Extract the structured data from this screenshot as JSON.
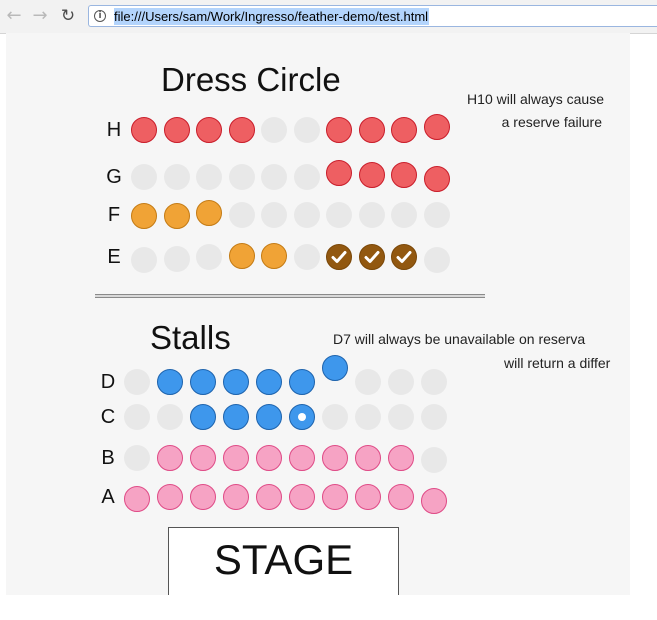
{
  "browser": {
    "back_icon": "arrow-left-icon",
    "forward_icon": "arrow-right-icon",
    "reload_icon": "reload-icon",
    "info_icon": "info-icon",
    "url": "file:///Users/sam/Work/Ingresso/feather-demo/test.html"
  },
  "seat_colors": {
    "unavailable": "#e8e8e8",
    "red": "#ee5f62",
    "orange": "#f0a336",
    "selected": "#925810",
    "blue": "#3e97ec",
    "pink": "#f6a3c4"
  },
  "dress_circle": {
    "title": "Dress Circle",
    "note_line1": "H10 will always cause",
    "note_line2": "a reserve failure",
    "rows": [
      {
        "label": "H",
        "seats": [
          "red",
          "red",
          "red",
          "red",
          "unavailable",
          "unavailable",
          "red",
          "red",
          "red",
          "red"
        ]
      },
      {
        "label": "G",
        "seats": [
          "unavailable",
          "unavailable",
          "unavailable",
          "unavailable",
          "unavailable",
          "unavailable",
          "red",
          "red",
          "red",
          "red"
        ]
      },
      {
        "label": "F",
        "seats": [
          "orange",
          "orange",
          "orange",
          "unavailable",
          "unavailable",
          "unavailable",
          "unavailable",
          "unavailable",
          "unavailable",
          "unavailable"
        ]
      },
      {
        "label": "E",
        "seats": [
          "unavailable",
          "unavailable",
          "unavailable",
          "orange",
          "orange",
          "unavailable",
          "selected",
          "selected",
          "selected",
          "unavailable"
        ]
      }
    ]
  },
  "stalls": {
    "title": "Stalls",
    "note_line1": "D7 will always be unavailable on reserva",
    "note_line2": "will return a differ",
    "rows": [
      {
        "label": "D",
        "seats": [
          "unavailable",
          "blue",
          "blue",
          "blue",
          "blue",
          "blue",
          "blue",
          "unavailable",
          "unavailable",
          "unavailable"
        ]
      },
      {
        "label": "C",
        "seats": [
          "unavailable",
          "unavailable",
          "blue",
          "blue",
          "blue",
          "blue-dot",
          "unavailable",
          "unavailable",
          "unavailable",
          "unavailable"
        ]
      },
      {
        "label": "B",
        "seats": [
          "unavailable",
          "pink",
          "pink",
          "pink",
          "pink",
          "pink",
          "pink",
          "pink",
          "pink",
          "unavailable"
        ]
      },
      {
        "label": "A",
        "seats": [
          "pink",
          "pink",
          "pink",
          "pink",
          "pink",
          "pink",
          "pink",
          "pink",
          "pink",
          "pink"
        ]
      }
    ]
  },
  "stage": {
    "label": "STAGE"
  }
}
